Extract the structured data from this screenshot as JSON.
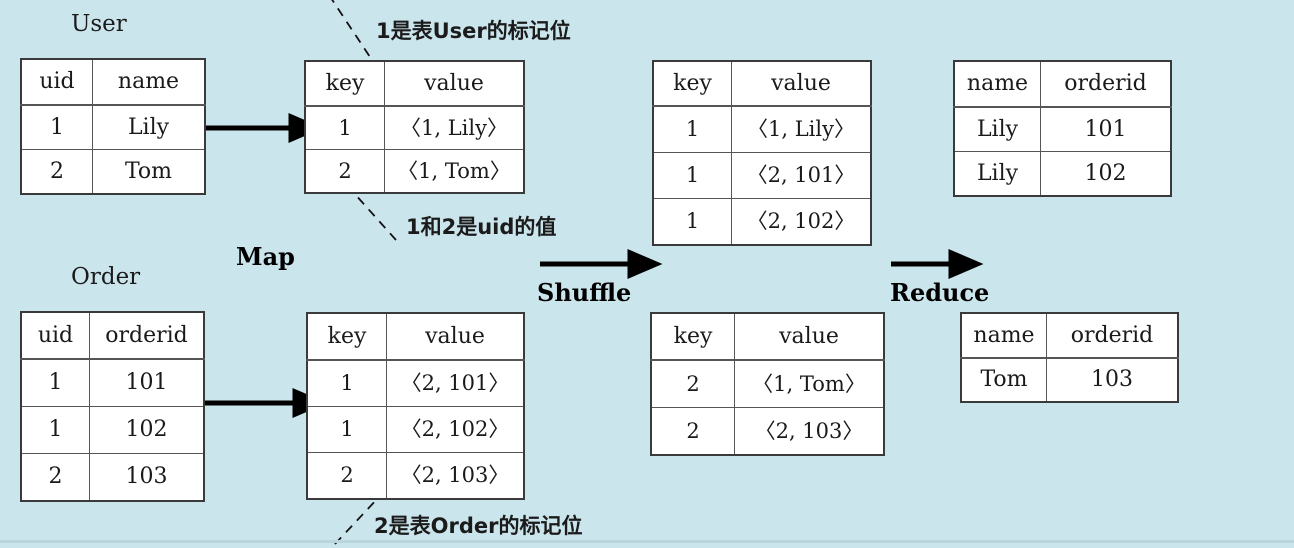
{
  "diagram": {
    "title_user": "User",
    "title_order": "Order",
    "background_color": "#cbe5ed",
    "table_border_color": "#3a3a3a"
  },
  "stages": {
    "map": "Map",
    "shuffle": "Shuffle",
    "reduce": "Reduce"
  },
  "annotations": {
    "user_flag": "1是表User的标记位",
    "uid_values": "1和2是uid的值",
    "order_flag": "2是表Order的标记位"
  },
  "tables": {
    "user_source": {
      "headers": [
        "uid",
        "name"
      ],
      "rows": [
        [
          "1",
          "Lily"
        ],
        [
          "2",
          "Tom"
        ]
      ]
    },
    "order_source": {
      "headers": [
        "uid",
        "orderid"
      ],
      "rows": [
        [
          "1",
          "101"
        ],
        [
          "1",
          "102"
        ],
        [
          "2",
          "103"
        ]
      ]
    },
    "map_user_out": {
      "headers": [
        "key",
        "value"
      ],
      "rows": [
        [
          "1",
          "〈1, Lily〉"
        ],
        [
          "2",
          "〈1, Tom〉"
        ]
      ]
    },
    "map_order_out": {
      "headers": [
        "key",
        "value"
      ],
      "rows": [
        [
          "1",
          "〈2, 101〉"
        ],
        [
          "1",
          "〈2, 102〉"
        ],
        [
          "2",
          "〈2, 103〉"
        ]
      ]
    },
    "shuffle_key1": {
      "headers": [
        "key",
        "value"
      ],
      "rows": [
        [
          "1",
          "〈1, Lily〉"
        ],
        [
          "1",
          "〈2, 101〉"
        ],
        [
          "1",
          "〈2, 102〉"
        ]
      ]
    },
    "shuffle_key2": {
      "headers": [
        "key",
        "value"
      ],
      "rows": [
        [
          "2",
          "〈1, Tom〉"
        ],
        [
          "2",
          "〈2, 103〉"
        ]
      ]
    },
    "reduce_out_1": {
      "headers": [
        "name",
        "orderid"
      ],
      "rows": [
        [
          "Lily",
          "101"
        ],
        [
          "Lily",
          "102"
        ]
      ]
    },
    "reduce_out_2": {
      "headers": [
        "name",
        "orderid"
      ],
      "rows": [
        [
          "Tom",
          "103"
        ]
      ]
    }
  }
}
